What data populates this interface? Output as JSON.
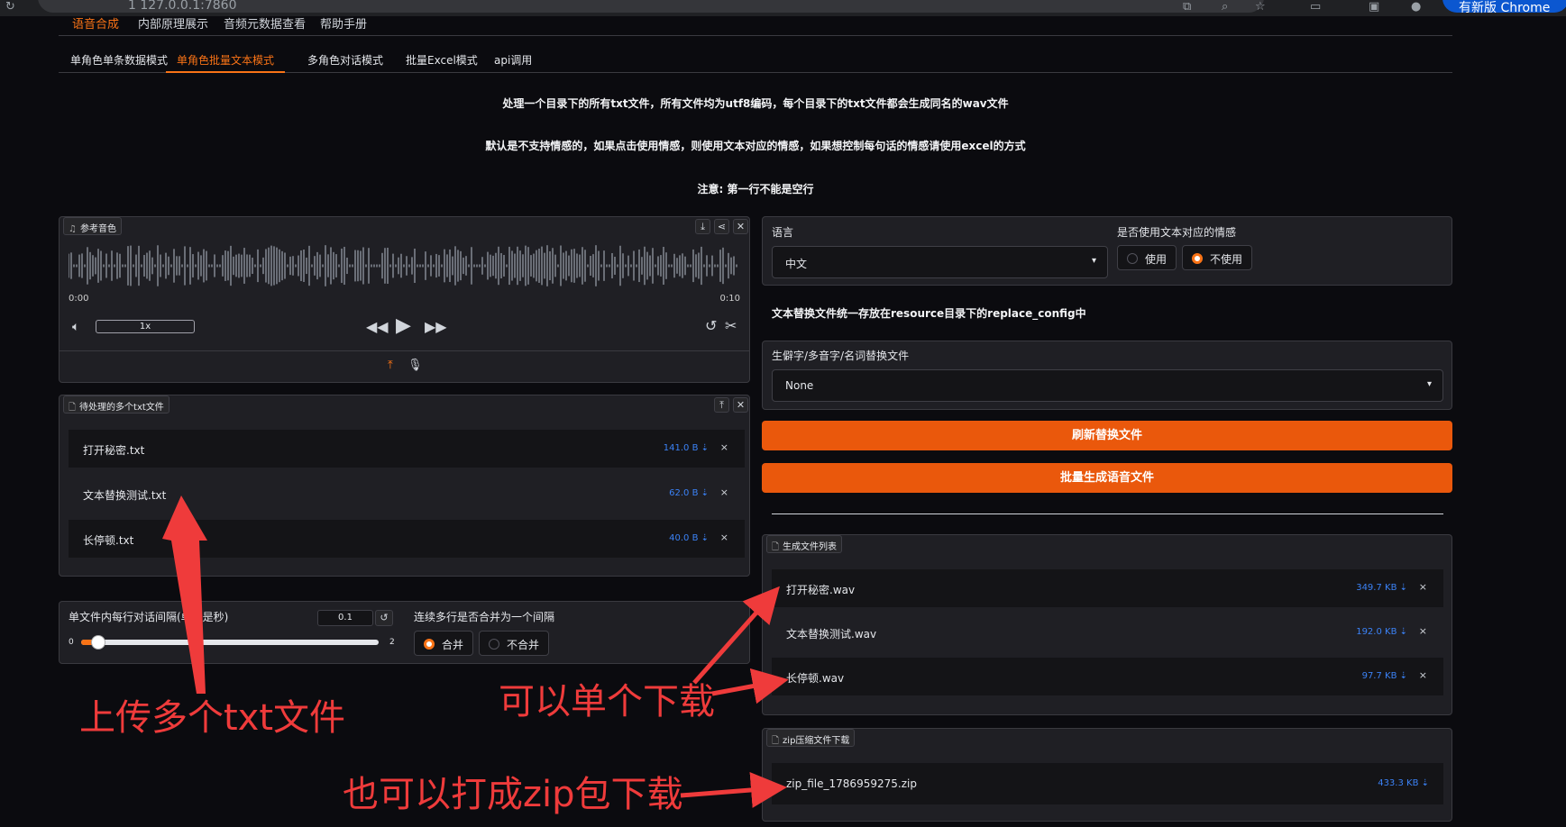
{
  "browser": {
    "url": "1 127.0.0.1:7860",
    "update_label": "有新版 Chrome"
  },
  "top_tabs": [
    "语音合成",
    "内部原理展示",
    "音频元数据查看",
    "帮助手册"
  ],
  "sub_tabs": [
    "单角色单条数据模式",
    "单角色批量文本模式",
    "多角色对话模式",
    "批量Excel模式",
    "api调用"
  ],
  "notes": [
    "处理一个目录下的所有txt文件，所有文件均为utf8编码，每个目录下的txt文件都会生成同名的wav文件",
    "默认是不支持情感的，如果点击使用情感，则使用文本对应的情感，如果想控制每句话的情感请使用excel的方式",
    "注意: 第一行不能是空行"
  ],
  "audio": {
    "label": "参考音色",
    "time_start": "0:00",
    "time_end": "0:10",
    "speed": "1x"
  },
  "input_files": {
    "label": "待处理的多个txt文件",
    "files": [
      {
        "name": "打开秘密.txt",
        "size": "141.0 B ⇣"
      },
      {
        "name": "文本替换测试.txt",
        "size": "62.0 B ⇣"
      },
      {
        "name": "长停顿.txt",
        "size": "40.0 B ⇣"
      }
    ]
  },
  "interval": {
    "label": "单文件内每行对话间隔(单位是秒)",
    "value": "0.1",
    "min": "0",
    "max": "2",
    "fraction": 0.05
  },
  "merge": {
    "label": "连续多行是否合并为一个间隔",
    "options": [
      "合并",
      "不合并"
    ],
    "selected": "合并"
  },
  "language": {
    "label": "语言",
    "value": "中文"
  },
  "emotion": {
    "label": "是否使用文本对应的情感",
    "options": [
      "使用",
      "不使用"
    ],
    "selected": "不使用"
  },
  "replace_note": "文本替换文件统一存放在resource目录下的replace_config中",
  "replace_file": {
    "label": "生僻字/多音字/名词替换文件",
    "value": "None"
  },
  "buttons": {
    "refresh": "刷新替换文件",
    "generate": "批量生成语音文件"
  },
  "output_files": {
    "label": "生成文件列表",
    "files": [
      {
        "name": "打开秘密.wav",
        "size": "349.7 KB ⇣"
      },
      {
        "name": "文本替换测试.wav",
        "size": "192.0 KB ⇣"
      },
      {
        "name": "长停顿.wav",
        "size": "97.7 KB ⇣"
      }
    ]
  },
  "zip": {
    "label": "zip压缩文件下载",
    "file": {
      "name": "zip_file_1786959275.zip",
      "size": "433.3 KB ⇣"
    }
  },
  "annotations": {
    "upload": "上传多个txt文件",
    "single": "可以单个下载",
    "zip": "也可以打成zip包下载"
  },
  "colors": {
    "accent": "#ea580c",
    "annotation": "#ef3b3b",
    "link": "#3b82f6",
    "background": "#0b0b0f"
  }
}
